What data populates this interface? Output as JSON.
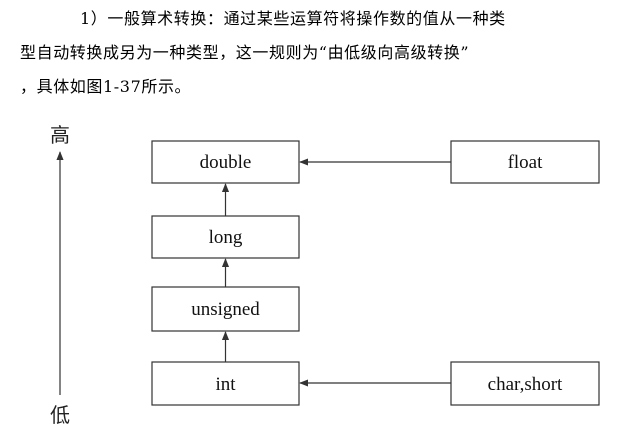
{
  "paragraph": {
    "line1": "1）一般算术转换：通过某些运算符将操作数的值从一种类",
    "line2": "型自动转换成另为一种类型，这一规则为“由低级向高级转换”",
    "line3": "，具体如图1-37所示。"
  },
  "diagram": {
    "axis_high": "高",
    "axis_low": "低",
    "boxes": {
      "double": "double",
      "float": "float",
      "long": "long",
      "unsigned": "unsigned",
      "int": "int",
      "char_short": "char,short"
    },
    "colors": {
      "stroke": "#333333",
      "text": "#111111",
      "background": "#ffffff"
    }
  }
}
